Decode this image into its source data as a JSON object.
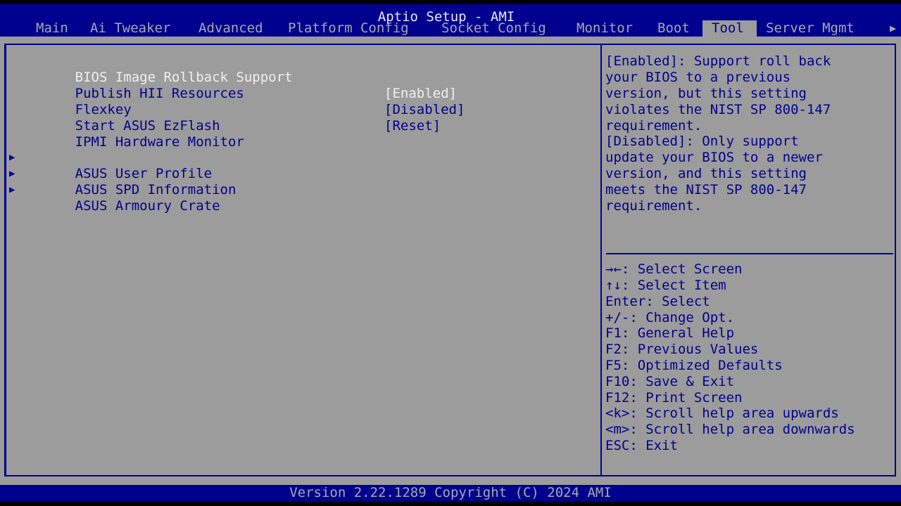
{
  "header": {
    "title": "Aptio Setup - AMI",
    "tabs": [
      {
        "label": "Main"
      },
      {
        "label": "Ai Tweaker"
      },
      {
        "label": "Advanced"
      },
      {
        "label": "Platform Config"
      },
      {
        "label": "Socket Config"
      },
      {
        "label": "Monitor"
      },
      {
        "label": "Boot"
      },
      {
        "label": "Tool",
        "active": true
      },
      {
        "label": "Server Mgmt"
      }
    ],
    "more_icon": "triangle-right-icon",
    "more_glyph": "▶"
  },
  "menu": {
    "submenu_glyph": "▶",
    "items": [
      {
        "label": "BIOS Image Rollback Support",
        "value": "[Enabled]",
        "selected": true
      },
      {
        "label": "Publish HII Resources",
        "value": "[Disabled]"
      },
      {
        "label": "Flexkey",
        "value": "[Reset]"
      },
      {
        "label": "Start ASUS EzFlash"
      },
      {
        "label": "IPMI Hardware Monitor"
      },
      {
        "label": "ASUS User Profile",
        "submenu": true
      },
      {
        "label": "ASUS SPD Information",
        "submenu": true
      },
      {
        "label": "ASUS Armoury Crate",
        "submenu": true
      }
    ]
  },
  "help": {
    "lines": [
      "[Enabled]: Support roll back",
      "your BIOS to a previous",
      "version, but this setting",
      "violates the NIST SP 800-147",
      "requirement.",
      "[Disabled]: Only support",
      "update your BIOS to a newer",
      "version, and this setting",
      "meets the NIST SP 800-147",
      "requirement."
    ]
  },
  "keys": {
    "lines": [
      "→←: Select Screen",
      "↑↓: Select Item",
      "Enter: Select",
      "+/-: Change Opt.",
      "F1: General Help",
      "F2: Previous Values",
      "F5: Optimized Defaults",
      "F10: Save & Exit",
      "F12: Print Screen",
      "<k>: Scroll help area upwards",
      "<m>: Scroll help area downwards",
      "ESC: Exit"
    ]
  },
  "footer": {
    "text": "Version 2.22.1289 Copyright (C) 2024 AMI"
  },
  "colors": {
    "bar_blue": "#00008f",
    "panel_gray": "#9c9c9c",
    "selected_text": "#f0f0f0"
  }
}
